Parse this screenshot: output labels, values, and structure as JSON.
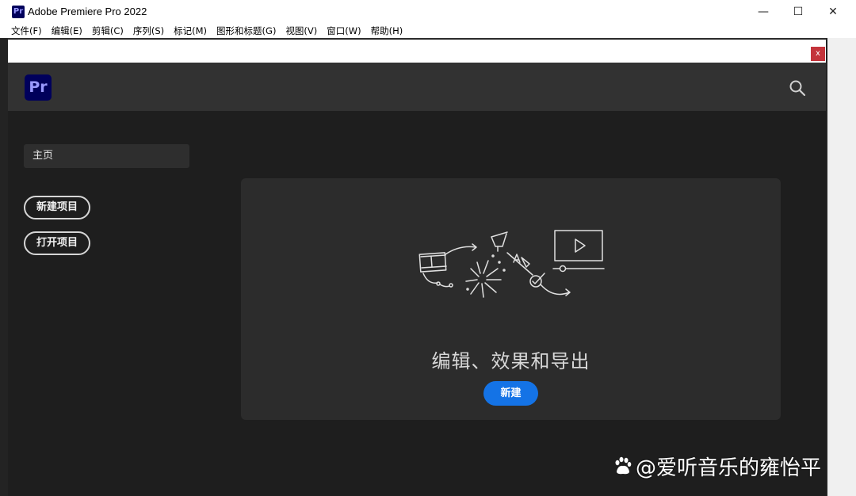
{
  "window": {
    "title": "Adobe Premiere Pro 2022",
    "app_icon_text": "Pr",
    "minimize": "—",
    "maximize": "☐",
    "close": "✕"
  },
  "menu": {
    "items": [
      {
        "label": "文件(F)"
      },
      {
        "label": "编辑(E)"
      },
      {
        "label": "剪辑(C)"
      },
      {
        "label": "序列(S)"
      },
      {
        "label": "标记(M)"
      },
      {
        "label": "图形和标题(G)"
      },
      {
        "label": "视图(V)"
      },
      {
        "label": "窗口(W)"
      },
      {
        "label": "帮助(H)"
      }
    ]
  },
  "home": {
    "close_label": "x",
    "logo_text": "Pr",
    "search_icon": "search-icon",
    "nav_home": "主页",
    "new_project": "新建项目",
    "open_project": "打开项目",
    "card_title": "编辑、效果和导出",
    "card_button": "新建"
  },
  "watermark": {
    "text": "@爱听音乐的雍怡平"
  },
  "colors": {
    "accent": "#1473e6",
    "pr_brand_bg": "#00005b",
    "pr_brand_fg": "#9999ff",
    "close_red": "#c4343b"
  }
}
